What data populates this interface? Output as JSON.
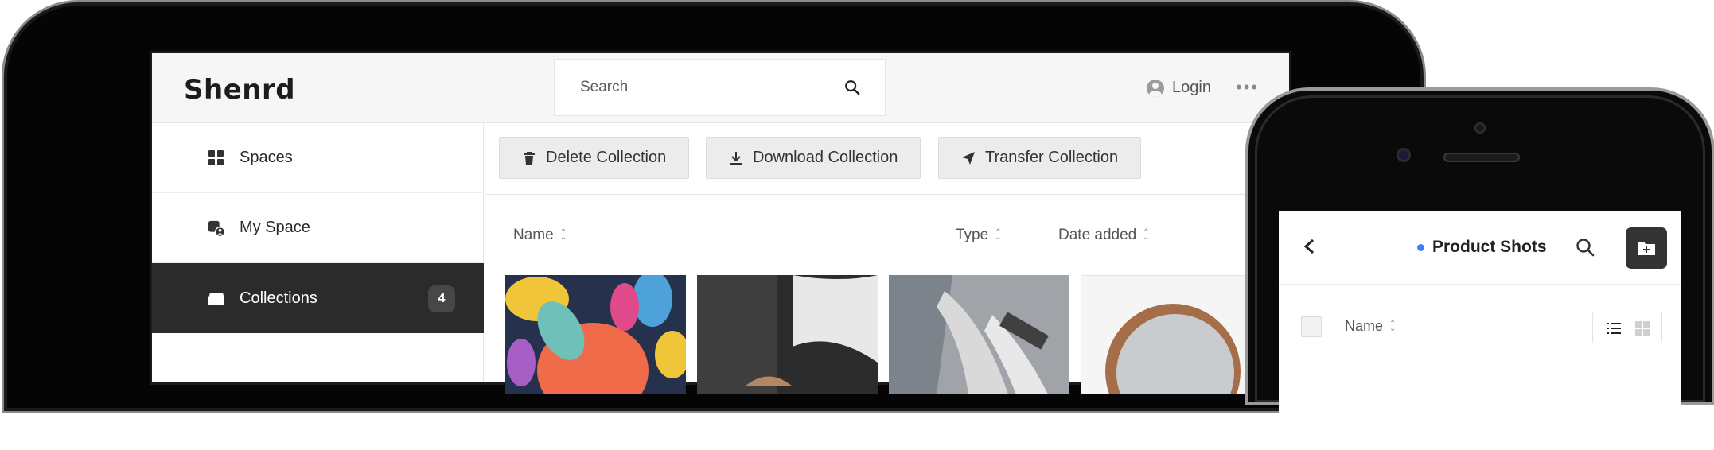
{
  "app": {
    "logo_text": "Shenrd"
  },
  "header": {
    "search_placeholder": "Search",
    "login_label": "Login",
    "more_label": "•••"
  },
  "sidebar": {
    "items": [
      {
        "label": "Spaces",
        "icon": "grid-icon"
      },
      {
        "label": "My Space",
        "icon": "user-space-icon"
      },
      {
        "label": "Collections",
        "icon": "folder-icon",
        "badge": "4",
        "active": true
      }
    ]
  },
  "toolbar": {
    "delete_label": "Delete Collection",
    "download_label": "Download Collection",
    "transfer_label": "Transfer Collection"
  },
  "list_header": {
    "name": "Name",
    "type": "Type",
    "date_added": "Date added"
  },
  "phone": {
    "title": "Product Shots",
    "name_col": "Name"
  },
  "colors": {
    "active_nav_bg": "#2b2b2b",
    "accent_dot": "#3a82f7",
    "button_bg": "#ececec"
  }
}
